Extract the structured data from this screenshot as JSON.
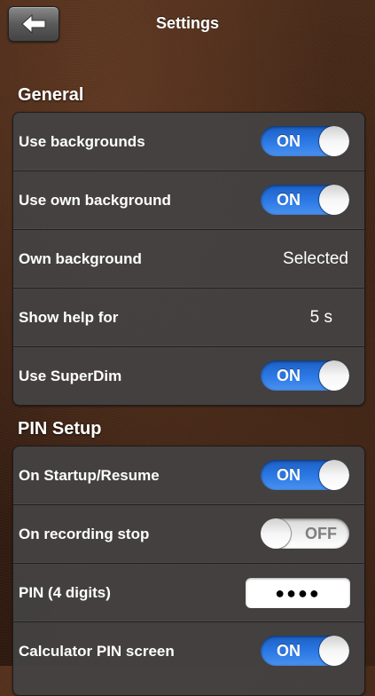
{
  "header": {
    "title": "Settings",
    "back_icon": "back-arrow-icon"
  },
  "sections": [
    {
      "title": "General",
      "rows": [
        {
          "label": "Use backgrounds",
          "type": "toggle",
          "state": "ON"
        },
        {
          "label": "Use own background",
          "type": "toggle",
          "state": "ON"
        },
        {
          "label": "Own background",
          "type": "value",
          "value": "Selected"
        },
        {
          "label": "Show help for",
          "type": "value",
          "value": "5 s"
        },
        {
          "label": "Use SuperDim",
          "type": "toggle",
          "state": "ON"
        }
      ]
    },
    {
      "title": "PIN Setup",
      "rows": [
        {
          "label": "On Startup/Resume",
          "type": "toggle",
          "state": "ON"
        },
        {
          "label": "On recording stop",
          "type": "toggle",
          "state": "OFF"
        },
        {
          "label": "PIN (4 digits)",
          "type": "pin",
          "value": "●●●●"
        },
        {
          "label": "Calculator PIN screen",
          "type": "toggle",
          "state": "ON"
        }
      ]
    }
  ],
  "colors": {
    "toggle_on": "#2d7ae6",
    "row_bg": "#444242",
    "accent_text": "#ffffff"
  }
}
